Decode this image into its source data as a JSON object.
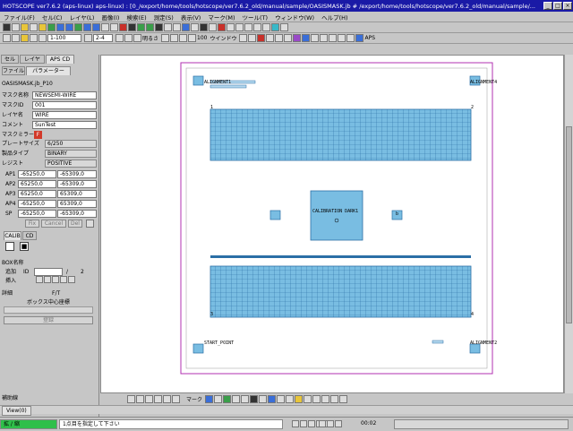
{
  "window": {
    "title": "HOTSCOPE ver7.6.2 (aps-linux) aps-linux) : [0_/export/home/tools/hotscope/ver7.6.2_old/manual/sample/OASISMASK.jb # /export/home/tools/hotscope/ver7.6.2_old/manual/sample/..."
  },
  "menu": [
    "ファイル(F)",
    "セル(C)",
    "レイヤ(L)",
    "画像(I)",
    "検索(E)",
    "測定(S)",
    "表示(V)",
    "マーク(M)",
    "ツール(T)",
    "ウィンドウ(W)",
    "ヘルプ(H)"
  ],
  "toolbar": {
    "zoom_value": "1-100",
    "ratio_value": "2-4",
    "brightness_label": "明るさ",
    "level_value": "100",
    "window_label": "ウインドウ",
    "aps_label": "APS"
  },
  "panel": {
    "tabs": [
      "セル",
      "レイヤ",
      "APS CD"
    ],
    "subtabs": [
      "ファイル",
      "パラメーター"
    ],
    "file_name": "OASISMASK.jb_P10",
    "fields": [
      {
        "label": "マスク名称",
        "value": "NEWSEMI-WIRE"
      },
      {
        "label": "マスクID",
        "value": "001"
      },
      {
        "label": "レイヤ名",
        "value": "WIRE"
      },
      {
        "label": "コメント",
        "value": "SunTest"
      }
    ],
    "mirror_label": "マスクミラー",
    "mirror_value": "F",
    "dropdowns": [
      {
        "label": "プレートサイズ",
        "value": "6/250"
      },
      {
        "label": "製品タイプ",
        "value": "BINARY"
      },
      {
        "label": "レジスト",
        "value": "POSITIVE"
      }
    ],
    "coords": [
      {
        "label": "AP1",
        "x": "-65250,0",
        "y": "-65309,0"
      },
      {
        "label": "AP2",
        "x": "65250,0",
        "y": "-65309,0"
      },
      {
        "label": "AP3",
        "x": "65250,0",
        "y": "65309,0"
      },
      {
        "label": "AP4",
        "x": "-65250,0",
        "y": "65309,0"
      },
      {
        "label": "SP",
        "x": "-65250,0",
        "y": "-65309,0"
      }
    ],
    "buttons": [
      "Fix",
      "Cancel",
      "Del"
    ],
    "calib_tabs": [
      "CALIB",
      "CD"
    ],
    "box_label": "BOX名称",
    "add_label": "追加",
    "id_label": "ID",
    "page_sep": "/",
    "page_total": "2",
    "insert_label": "挿入",
    "edit_label": "詳細",
    "fit_label": "F/T",
    "box_center_label": "ボックス中心座標",
    "register_button": "登録"
  },
  "canvas": {
    "labels": {
      "alignment1": "ALIGNMENT1",
      "alignment4": "ALIGNMENT4",
      "alignment2": "ALIGNMENT2",
      "start_point": "START_POINT",
      "calibration": "CALIBRATION DARK1",
      "corner1": "1",
      "corner2": "2",
      "corner3": "3",
      "corner4": "4",
      "small_label": "b"
    }
  },
  "bottom": {
    "left_label": "補助線",
    "mark_label": "マーク",
    "view_tab": "View(0)"
  },
  "status": {
    "mode": "拡 / 縮",
    "message": "1点目を指定して下さい",
    "time": "00:02"
  },
  "colors": {
    "title_bar": "#1a1aa6",
    "pattern_fill": "#79bde2",
    "pattern_line": "#2b6fa6",
    "status_green": "#2fbf4a",
    "mask_border": "#b030b0"
  }
}
